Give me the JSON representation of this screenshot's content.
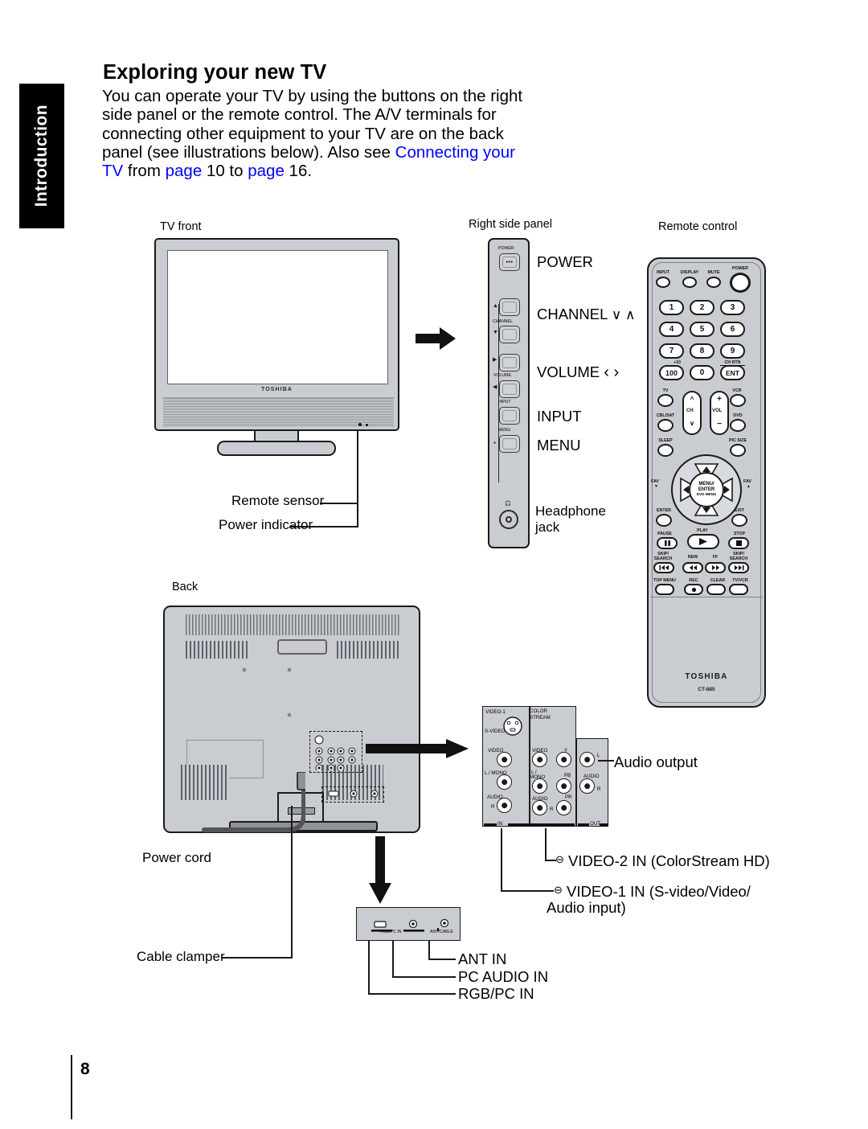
{
  "sidebar": {
    "tab_label": "Introduction"
  },
  "header": {
    "title": "Exploring your new TV",
    "body_part1": "You can operate your TV by using the buttons on the right side panel or the remote control. The A/V terminals for connecting other equipment to your TV are on the back panel (see illustrations below). Also see ",
    "link_connecting": "Connecting your TV",
    "body_part2": " from ",
    "link_page_word1": "page",
    "link_page_num1": "10",
    "body_part3": " to ",
    "link_page_word2": "page",
    "link_page_num2": "16",
    "body_part4": "."
  },
  "footer": {
    "page_number": "8"
  },
  "figures": {
    "tv_front_caption": "TV front",
    "side_panel_caption": "Right side panel",
    "remote_caption": "Remote control",
    "back_caption": "Back"
  },
  "tv_front": {
    "brand": "TOSHIBA",
    "callout_remote_sensor": "Remote sensor",
    "callout_power_indicator": "Power indicator"
  },
  "side_panel": {
    "button_labels": {
      "power": "POWER",
      "channel": "CHANNEL",
      "volume": "VOLUME",
      "input": "INPUT",
      "menu": "MENU"
    },
    "annotations": [
      {
        "label": "POWER"
      },
      {
        "label": "CHANNEL",
        "glyphs": "∨   ∧"
      },
      {
        "label": "VOLUME",
        "glyphs": "‹     ›"
      },
      {
        "label": "INPUT"
      },
      {
        "label": "MENU"
      }
    ],
    "headphone_label_line1": "Headphone",
    "headphone_label_line2": "jack"
  },
  "remote": {
    "top_row": [
      "INPUT",
      "DISPLAY",
      "MUTE",
      "POWER"
    ],
    "keypad": [
      [
        "1",
        "2",
        "3"
      ],
      [
        "4",
        "5",
        "6"
      ],
      [
        "7",
        "8",
        "9"
      ],
      [
        "100",
        "0",
        "ENT"
      ]
    ],
    "keypad_super_left": "+10",
    "keypad_super_right": "CH RTN",
    "mode_buttons": [
      "TV",
      "VCR",
      "CBL/SAT",
      "DVD"
    ],
    "ch_label": "CH",
    "vol_label": "VOL",
    "vol_plus": "+",
    "vol_minus": "−",
    "sleep_label": "SLEEP",
    "pic_size_label": "PIC SIZE",
    "fav_left": "FAV",
    "fav_right": "FAV",
    "center_line1": "MENU/",
    "center_line2": "ENTER",
    "center_line3": "DVD MENU",
    "enter_label": "ENTER",
    "exit_label": "EXIT",
    "transport": {
      "pause": "PAUSE",
      "play": "PLAY",
      "stop": "STOP",
      "skip_left_line1": "SKIP/",
      "skip_left_line2": "SEARCH",
      "rew": "REW",
      "ff": "FF",
      "skip_right_line1": "SKIP/",
      "skip_right_line2": "SEARCH"
    },
    "bottom_row": [
      "TOP MENU",
      "REC",
      "CLEAR",
      "TV/VCR"
    ],
    "brand": "TOSHIBA",
    "model": "CT-885"
  },
  "tv_back": {
    "callout_power_cord": "Power cord",
    "callout_cable_clamper": "Cable clamper"
  },
  "terminals": {
    "video1_label": "VIDEO-1",
    "svideo_label": "S-VIDEO",
    "colorstream_line1": "COLOR",
    "colorstream_line2": "STREAM",
    "video_label": "VIDEO",
    "l_mono_label": "L / MONO",
    "l_mono_label2": "L /",
    "mono_label": "MONO",
    "audio_label": "AUDIO",
    "r_label": "R",
    "l_label": "L",
    "y_label": "Y",
    "pb_label": "PB",
    "pr_label": "PR",
    "in_label": "IN",
    "out_label": "OUT",
    "callout_audio_output": "Audio output",
    "callout_video2": "VIDEO-2 IN (ColorStream HD)",
    "callout_video1_line1": "VIDEO-1 IN (S-video/Video/",
    "callout_video1_line2": "Audio input)"
  },
  "bottom_strip": {
    "rgb_pc_tiny": "RGB/PC IN",
    "pc_audio_tiny": "PC AUDIO IN",
    "ant_tiny": "ANT/CABLE",
    "callout_ant": "ANT IN",
    "callout_pc_audio": "PC AUDIO IN",
    "callout_rgb_pc": "RGB/PC IN"
  },
  "colors": {
    "link": "#0000FF",
    "tab_background": "#000000",
    "device_body": "#c9ccd1",
    "outline": "#1a1a1a"
  }
}
